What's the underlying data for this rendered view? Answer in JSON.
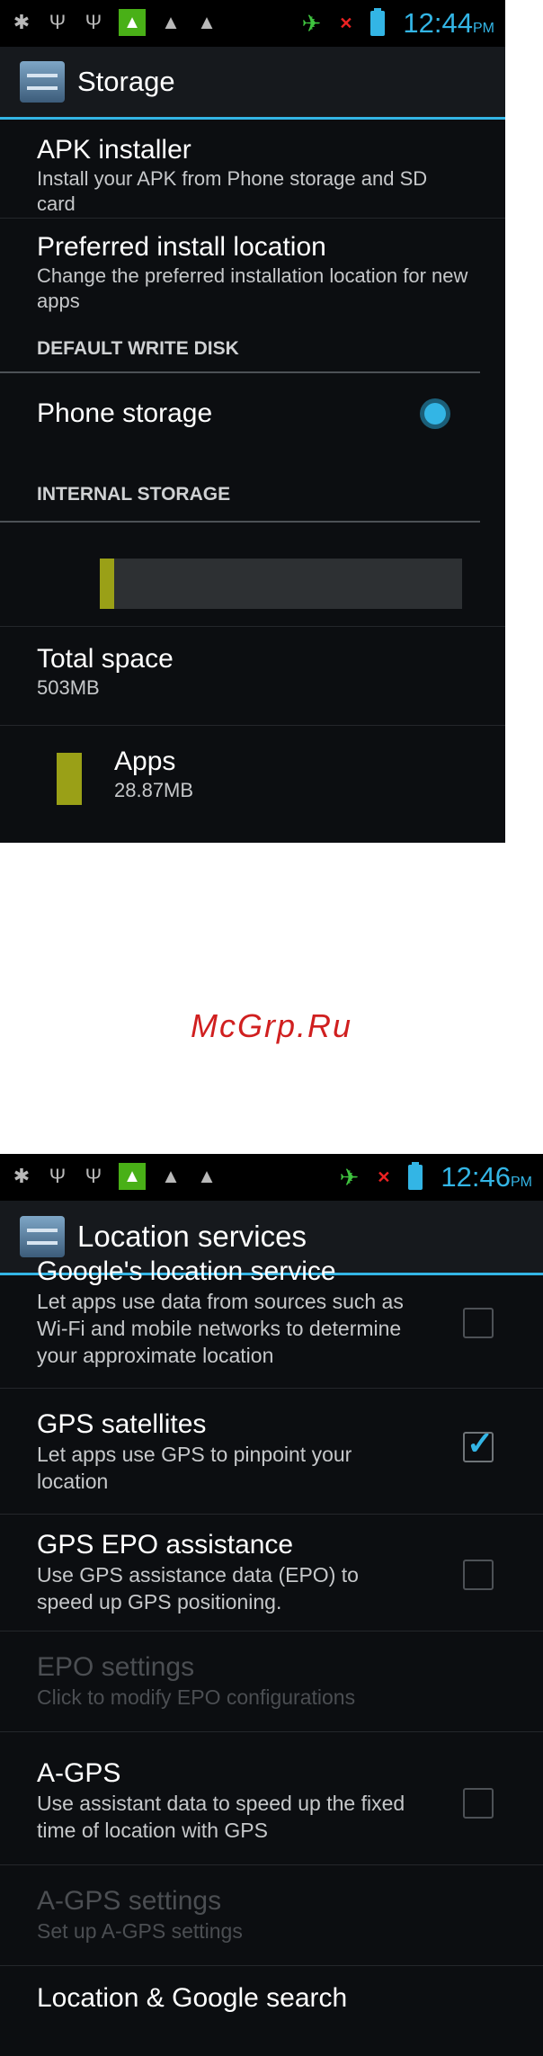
{
  "screen1": {
    "status": {
      "time": "12:44",
      "ampm": "PM"
    },
    "title": "Storage",
    "apk": {
      "title": "APK installer",
      "summary": "Install your APK from Phone storage and SD card"
    },
    "install_location": {
      "title": "Preferred install location",
      "summary": "Change the preferred installation location for new apps"
    },
    "default_write_disk": "DEFAULT WRITE DISK",
    "phone_storage": "Phone storage",
    "internal_storage": "INTERNAL STORAGE",
    "usage_fraction": 0.04,
    "total_space": {
      "title": "Total space",
      "value": "503MB"
    },
    "apps": {
      "title": "Apps",
      "value": "28.87MB"
    },
    "accent_color": "#9aa017"
  },
  "watermark": "McGrp.Ru",
  "screen2": {
    "status": {
      "time": "12:46",
      "ampm": "PM"
    },
    "title": "Location services",
    "items": [
      {
        "title": "Google's location service",
        "summary": "Let apps use data from sources such as Wi-Fi and mobile networks to determine your approximate location",
        "checked": false
      },
      {
        "title": "GPS satellites",
        "summary": "Let apps use GPS to pinpoint your location",
        "checked": true
      },
      {
        "title": "GPS EPO assistance",
        "summary": "Use GPS assistance data (EPO) to speed up GPS positioning.",
        "checked": false
      },
      {
        "title": "EPO settings",
        "summary": "Click to modify EPO configurations",
        "disabled": true
      },
      {
        "title": "A-GPS",
        "summary": "Use assistant data to speed up the fixed time of location with GPS",
        "checked": false
      },
      {
        "title": "A-GPS settings",
        "summary": "Set up A-GPS settings",
        "disabled": true
      },
      {
        "title": "Location & Google search"
      }
    ]
  }
}
